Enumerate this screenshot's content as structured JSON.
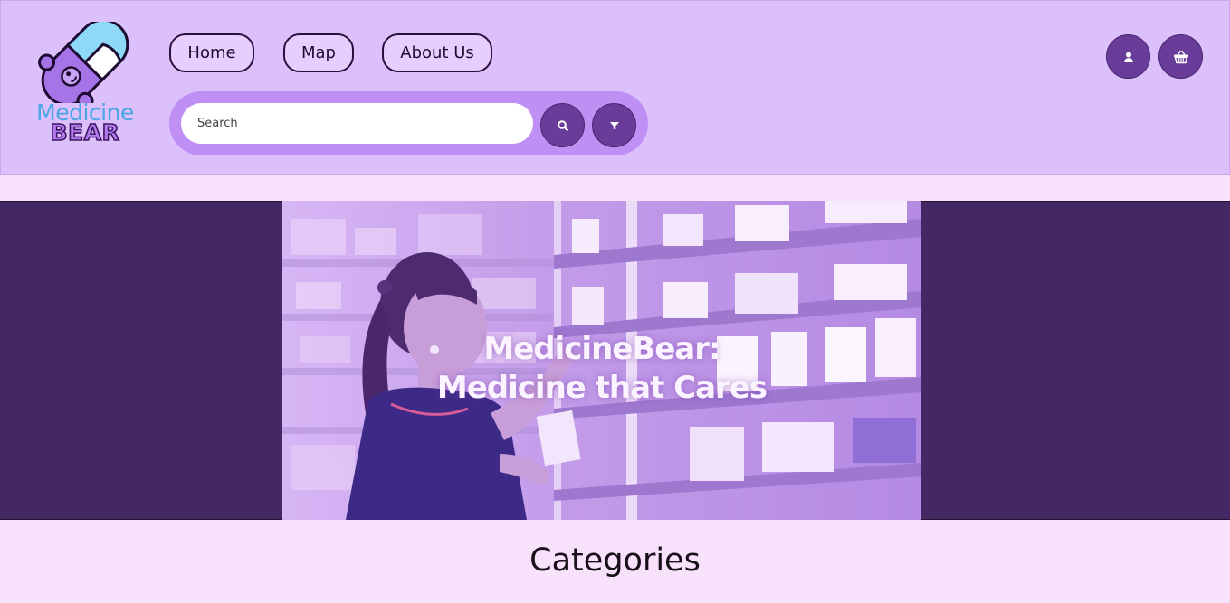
{
  "logo": {
    "word1": "Medicine",
    "word2": "BEAR",
    "icon": "bear-pill-logo"
  },
  "nav": {
    "home": "Home",
    "map": "Map",
    "about": "About Us"
  },
  "search": {
    "placeholder": "Search",
    "button_icon": "search-icon",
    "filter_icon": "filter-icon"
  },
  "actions": {
    "account_icon": "user-icon",
    "cart_icon": "basket-icon"
  },
  "hero": {
    "line1": "MedicineBear:",
    "line2": "Medicine that Cares",
    "image": "pharmacist-photo"
  },
  "sections": {
    "categories": "Categories"
  },
  "colors": {
    "header_bg": "#dcc0fc",
    "page_bg": "#f8e1fb",
    "accent": "#6a3c99",
    "band": "#432863",
    "search_pill": "#bf8ff4"
  }
}
